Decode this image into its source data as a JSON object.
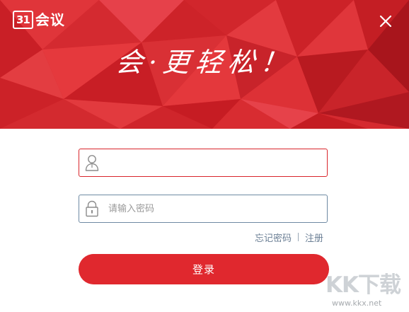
{
  "header": {
    "logo_mark": "31",
    "logo_text": "会议",
    "slogan": "会·更轻松！"
  },
  "login_form": {
    "username": {
      "value": "",
      "placeholder": "",
      "icon": "user-icon"
    },
    "password": {
      "value": "",
      "placeholder": "请输入密码",
      "icon": "lock-icon"
    },
    "forgot_password_label": "忘记密码",
    "register_label": "注册",
    "login_button_label": "登录"
  },
  "watermark": {
    "text": "KK下载",
    "url": "www.kkx.net"
  },
  "colors": {
    "brand_red": "#d9252b",
    "button_red": "#e0282e",
    "link_gray_blue": "#6b7f95",
    "input_border_blue": "#6e8aa3"
  }
}
